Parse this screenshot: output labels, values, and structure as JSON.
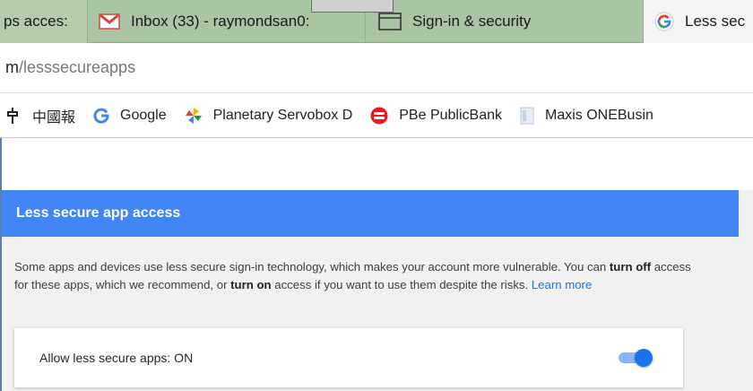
{
  "tabs": [
    {
      "label": "ps acces:",
      "icon": "partial-tab"
    },
    {
      "label": "Inbox (33) - raymondsan0:",
      "icon": "gmail-icon"
    },
    {
      "label": "Sign-in & security",
      "icon": "window-icon"
    },
    {
      "label": "Less sec",
      "icon": "google-icon",
      "active": true
    }
  ],
  "address": {
    "host": "m",
    "path": "/lesssecureapps"
  },
  "bookmarks": [
    {
      "label": "",
      "icon": "pin-icon"
    },
    {
      "label": "中國報",
      "icon": "none"
    },
    {
      "label": "Google",
      "icon": "google-g-icon"
    },
    {
      "label": "Planetary Servobox D",
      "icon": "pinwheel-icon"
    },
    {
      "label": "PBe PublicBank",
      "icon": "publicbank-icon"
    },
    {
      "label": "Maxis ONEBusin",
      "icon": "document-icon"
    }
  ],
  "main": {
    "header": "Less secure app access",
    "description": {
      "part1": "Some apps and devices use less secure sign-in technology, which makes your account more vulnerable. You can ",
      "turn_off": "turn off",
      "part2": " access for these apps, which we recommend, or ",
      "turn_on": "turn on",
      "part3": " access if you want to use them despite the risks. ",
      "learn_more": "Learn more"
    },
    "setting": {
      "label": "Allow less secure apps: ON",
      "toggle_state": "on"
    }
  },
  "colors": {
    "header_blue": "#4285f4",
    "link_blue": "#1a73e8",
    "tabstrip": "#a9c5a3"
  }
}
